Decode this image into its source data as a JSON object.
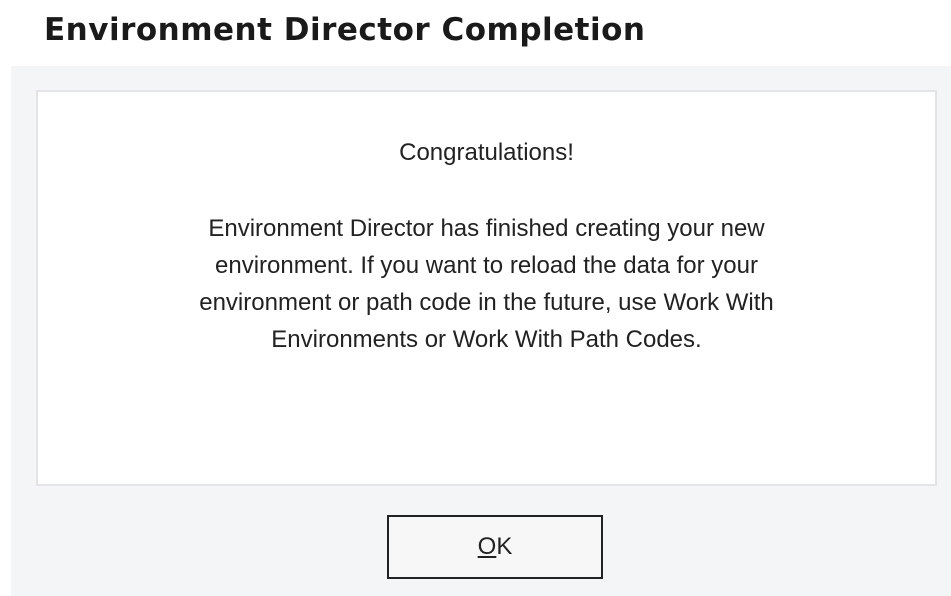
{
  "dialog": {
    "title": "Environment Director Completion",
    "heading": "Congratulations!",
    "message_lines": [
      "Environment Director has finished creating your new",
      "environment. If you want to reload the data for your",
      "environment or path code in the future, use Work With",
      "Environments or Work With Path Codes."
    ],
    "ok_button": {
      "mnemonic": "O",
      "rest": "K"
    }
  }
}
